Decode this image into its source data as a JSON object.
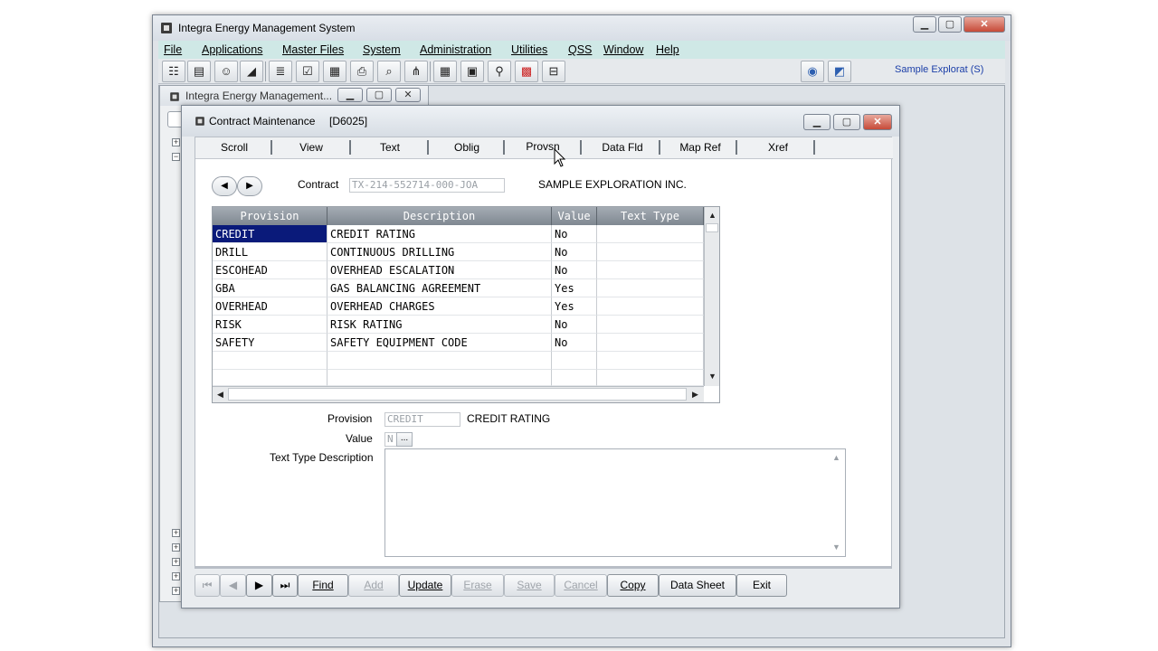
{
  "main_window": {
    "title": "Integra Energy Management System",
    "controls": {
      "minimize": "▭",
      "maximize": "□",
      "close": "✕"
    }
  },
  "menubar": {
    "items": [
      {
        "label": "File"
      },
      {
        "label": "Applications"
      },
      {
        "label": "Master Files"
      },
      {
        "label": "System"
      },
      {
        "label": "Administration"
      },
      {
        "label": "Utilities"
      },
      {
        "label": "QSS"
      },
      {
        "label": "Window"
      },
      {
        "label": "Help"
      }
    ]
  },
  "toolbar": {
    "company_label": "Sample Explorat  (S)",
    "icons": [
      "tree-icon",
      "book-icon",
      "user-icon",
      "chart-icon",
      "document-list-icon",
      "document-check-icon",
      "document-grid-icon",
      "printer-icon",
      "print-preview-icon",
      "hierarchy-icon",
      "calendar-icon",
      "window-icon",
      "link-icon",
      "palette-icon",
      "tray-icon",
      "globe-icon",
      "graph-icon"
    ]
  },
  "background_window": {
    "title": "Integra Energy Management..."
  },
  "contract_maintenance": {
    "title": "Contract Maintenance",
    "code": "[D6025]",
    "tabs": [
      {
        "label": "Scroll"
      },
      {
        "label": "View"
      },
      {
        "label": "Text"
      },
      {
        "label": "Oblig"
      },
      {
        "label": "Provsn"
      },
      {
        "label": "Data Fld"
      },
      {
        "label": "Map Ref"
      },
      {
        "label": "Xref"
      }
    ],
    "active_tab": "Provsn",
    "contract_label": "Contract",
    "contract_value": "TX-214-552714-000-JOA",
    "company_name": "SAMPLE EXPLORATION INC.",
    "grid": {
      "headers": [
        "Provision",
        "Description",
        "Value",
        "Text Type"
      ],
      "rows": [
        {
          "provision": "CREDIT",
          "description": "CREDIT RATING",
          "value": "No",
          "text_type": ""
        },
        {
          "provision": "DRILL",
          "description": "CONTINUOUS DRILLING",
          "value": "No",
          "text_type": ""
        },
        {
          "provision": "ESCOHEAD",
          "description": "OVERHEAD ESCALATION",
          "value": "No",
          "text_type": ""
        },
        {
          "provision": "GBA",
          "description": "GAS BALANCING AGREEMENT",
          "value": "Yes",
          "text_type": ""
        },
        {
          "provision": "OVERHEAD",
          "description": "OVERHEAD CHARGES",
          "value": "Yes",
          "text_type": ""
        },
        {
          "provision": "RISK",
          "description": "RISK RATING",
          "value": "No",
          "text_type": ""
        },
        {
          "provision": "SAFETY",
          "description": "SAFETY EQUIPMENT CODE",
          "value": "No",
          "text_type": ""
        }
      ]
    },
    "detail": {
      "provision_label": "Provision",
      "provision_value": "CREDIT",
      "provision_desc": "CREDIT RATING",
      "value_label": "Value",
      "value_value": "N",
      "value_btn": "...",
      "text_type_label": "Text Type Description",
      "text_type_value": ""
    },
    "buttons": {
      "find": "Find",
      "add": "Add",
      "update": "Update",
      "erase": "Erase",
      "save": "Save",
      "cancel": "Cancel",
      "copy": "Copy",
      "data_sheet": "Data Sheet",
      "exit": "Exit"
    }
  }
}
